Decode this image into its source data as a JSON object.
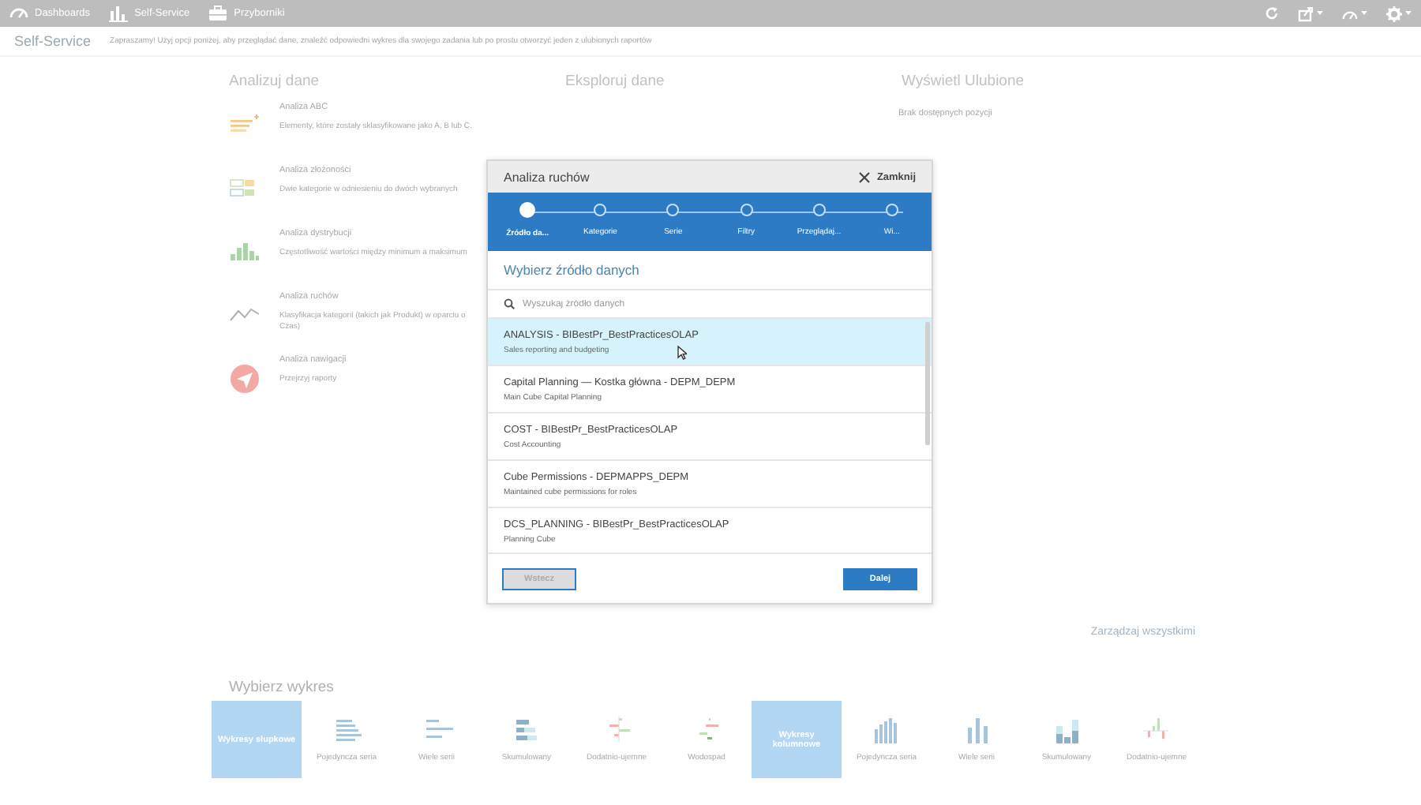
{
  "top_bar": {
    "nav": [
      {
        "kind": "dashboards",
        "label": "Dashboards"
      },
      {
        "kind": "self-service",
        "label": "Self-Service"
      },
      {
        "kind": "toolbox",
        "label": "Przyborniki"
      }
    ]
  },
  "page_header": {
    "title": "Self-Service",
    "description": "Zapraszamy! Użyj opcji poniżej, aby przeglądać dane, znaleźć odpowiedni wykres dla swojego zadania lub po prostu otworzyć jeden z ulubionych raportów"
  },
  "sections": [
    {
      "heading": "Analizuj dane"
    },
    {
      "heading": "Eksploruj dane"
    },
    {
      "heading": "Wyświetl Ulubione",
      "empty_text": "Brak dostępnych pozycji"
    }
  ],
  "analyses": [
    {
      "kind": "abc",
      "title": "Analiza ABC",
      "description": "Elementy, które zostały sklasyfikowane jako A, B lub C."
    },
    {
      "kind": "complexity",
      "title": "Analiza złożoności",
      "description": "Dwie kategorie w odniesieniu do dwóch wybranych"
    },
    {
      "kind": "distribution",
      "title": "Analiza dystrybucji",
      "description": "Częstotliwość wartości między minimum a maksimum"
    },
    {
      "kind": "movement",
      "title": "Analiza ruchów",
      "description": "Klasyfikacja kategorii (takich jak Produkt) w oparciu o Czas)"
    },
    {
      "kind": "navigation",
      "title": "Analiza nawigacji",
      "description": "Przejrzyj raporty"
    }
  ],
  "manage_link": "Zarządzaj wszystkimi",
  "chart_picker": {
    "title": "Wybierz wykres",
    "groups": [
      {
        "label": "Wykresy słupkowe",
        "kind": "bar",
        "types": [
          {
            "kind": "single",
            "label": "Pojedyncza seria"
          },
          {
            "kind": "multi",
            "label": "Wiele serii"
          },
          {
            "kind": "stacked",
            "label": "Skumulowany"
          },
          {
            "kind": "posneg",
            "label": "Dodatnio-ujemne"
          },
          {
            "kind": "waterfall",
            "label": "Wodospad"
          }
        ]
      },
      {
        "label": "Wykresy kolumnowe",
        "kind": "column",
        "types": [
          {
            "kind": "single",
            "label": "Pojedyncza seria"
          },
          {
            "kind": "multi",
            "label": "Wiele serii"
          },
          {
            "kind": "stacked",
            "label": "Skumulowany"
          },
          {
            "kind": "posneg",
            "label": "Dodatnio-ujemne"
          }
        ]
      }
    ]
  },
  "dialog": {
    "title": "Analiza ruchów",
    "close_label": "Zamknij",
    "steps": [
      {
        "label": "Źródło da...",
        "selected": true
      },
      {
        "label": "Kategorie",
        "selected": false
      },
      {
        "label": "Serie",
        "selected": false
      },
      {
        "label": "Filtry",
        "selected": false
      },
      {
        "label": "Przeglądaj...",
        "selected": false
      },
      {
        "label": "Wi...",
        "selected": false
      }
    ],
    "section_title": "Wybierz źródło danych",
    "search": {
      "placeholder": "Wyszukaj źródło danych"
    },
    "sources": [
      {
        "name": "ANALYSIS - BIBestPr_BestPracticesOLAP",
        "description": "Sales reporting and budgeting",
        "selected": true
      },
      {
        "name": "Capital Planning — Kostka główna - DEPM_DEPM",
        "description": "Main Cube Capital Planning",
        "selected": false
      },
      {
        "name": "COST - BIBestPr_BestPracticesOLAP",
        "description": "Cost Accounting",
        "selected": false
      },
      {
        "name": "Cube Permissions - DEPMAPPS_DEPM",
        "description": "Maintained cube permissions for roles",
        "selected": false
      },
      {
        "name": "DCS_PLANNING - BIBestPr_BestPracticesOLAP",
        "description": "Planning Cube",
        "selected": false
      }
    ],
    "buttons": [
      {
        "kind": "back",
        "label": "Wstecz",
        "disabled": true
      },
      {
        "kind": "next",
        "label": "Dalej",
        "disabled": false
      }
    ]
  }
}
